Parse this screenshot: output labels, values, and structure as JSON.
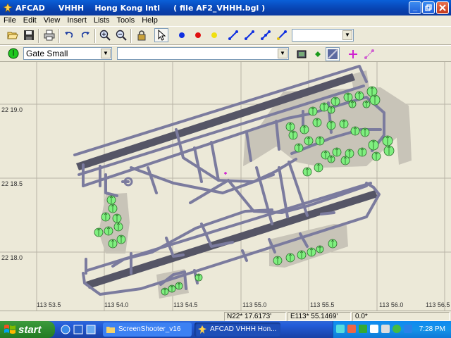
{
  "window": {
    "title": "AFCAD     VHHH    Hong Kong Intl     ( file AF2_VHHH.bgl )"
  },
  "menu": [
    "File",
    "Edit",
    "View",
    "Insert",
    "Lists",
    "Tools",
    "Help"
  ],
  "toolbar": {
    "icons": [
      "open-folder-icon",
      "save-icon",
      "print-icon",
      "undo-icon",
      "redo-icon",
      "zoom-in-icon",
      "zoom-out-icon",
      "lock-icon",
      "select-arrow-icon",
      "blue-node-icon",
      "red-node-icon",
      "yellow-node-icon",
      "blue-link-icon",
      "blue-link-2-icon",
      "blue-link-3-icon",
      "mixed-link-icon"
    ],
    "combo_right": ""
  },
  "toolbar2": {
    "parking_type": "Gate Small",
    "second_combo": "",
    "icons": [
      "runway-rect-icon",
      "diamond-icon",
      "taxi-tool-icon",
      "crosshair-icon",
      "diagonal-link-icon"
    ]
  },
  "map": {
    "lat_labels": [
      "22 19.0",
      "22 18.5",
      "22 18.0"
    ],
    "lon_labels": [
      "113 53.5",
      "113 54.0",
      "113 54.5",
      "113 55.0",
      "113 55.5",
      "113 56.0",
      "113 56.5"
    ],
    "colors": {
      "background": "#ece9d8",
      "grid": "#b8b4a6",
      "apron": "#c8c4b8",
      "taxiway": "#7b7b9e",
      "runway": "#555566",
      "parking": "#7ff07f",
      "parking_stroke": "#2a6a2a"
    }
  },
  "status": {
    "lat": "N22* 17.6173'",
    "lon": "E113* 55.1469'",
    "heading": "0.0*"
  },
  "taskbar": {
    "start_label": "start",
    "tasks": [
      "ScreenShooter_v16",
      "AFCAD    VHHH    Hon..."
    ],
    "clock": "7:28 PM"
  }
}
